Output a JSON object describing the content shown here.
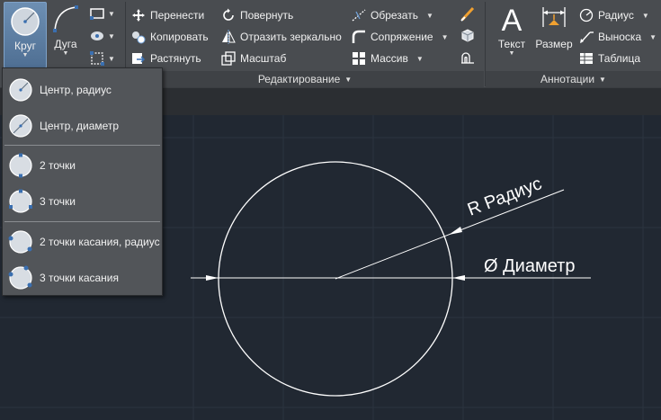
{
  "ribbon": {
    "draw_panel": {
      "circle_label": "Круг",
      "arc_label": "Дуга"
    },
    "modify_panel": {
      "title": "Редактирование",
      "items": [
        {
          "label": "Перенести",
          "icon": "move-icon"
        },
        {
          "label": "Повернуть",
          "icon": "rotate-icon"
        },
        {
          "label": "Обрезать",
          "icon": "trim-icon",
          "dropdown": true
        },
        {
          "label": "Копировать",
          "icon": "copy-icon"
        },
        {
          "label": "Отразить зеркально",
          "icon": "mirror-icon"
        },
        {
          "label": "Сопряжение",
          "icon": "fillet-icon",
          "dropdown": true
        },
        {
          "label": "Растянуть",
          "icon": "stretch-icon"
        },
        {
          "label": "Масштаб",
          "icon": "scale-icon"
        },
        {
          "label": "Массив",
          "icon": "array-icon",
          "dropdown": true
        }
      ]
    },
    "annotation_panel": {
      "title": "Аннотации",
      "text_label": "Текст",
      "dimension_label": "Размер",
      "radius_label": "Радиус",
      "leader_label": "Выноска",
      "table_label": "Таблица"
    }
  },
  "circle_menu": {
    "items": [
      {
        "label": "Центр, радиус",
        "icon": "circle-center-radius-icon"
      },
      {
        "label": "Центр, диаметр",
        "icon": "circle-center-diameter-icon"
      },
      {
        "label": "2 точки",
        "icon": "circle-2-points-icon"
      },
      {
        "label": "3 точки",
        "icon": "circle-3-points-icon"
      },
      {
        "label": "2 точки касания, радиус",
        "icon": "circle-tan-tan-radius-icon"
      },
      {
        "label": "3 точки касания",
        "icon": "circle-tan-tan-tan-icon"
      }
    ]
  },
  "drawing": {
    "radius_label": "R Радиус",
    "diameter_label": "Ø Диаметр"
  },
  "colors": {
    "ribbon_bg": "#494c50",
    "canvas_bg": "#212832",
    "menu_bg": "#525559",
    "active_button": "#5b7ea4",
    "drawing_line": "#ffffff"
  }
}
